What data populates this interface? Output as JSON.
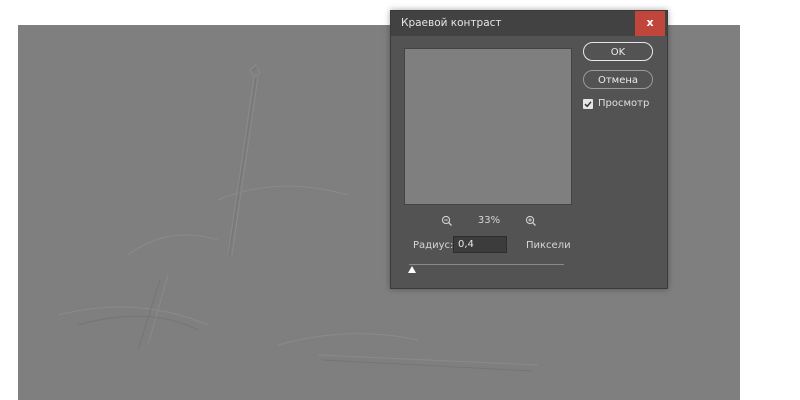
{
  "dialog": {
    "title": "Краевой контраст",
    "close_label": "x",
    "ok_label": "OK",
    "cancel_label": "Отмена",
    "preview_label": "Просмотр",
    "preview_checked": true,
    "zoom_level": "33%",
    "radius_label": "Радиус:",
    "radius_value": "0,4",
    "radius_units": "Пиксели",
    "slider_level": 0.02
  },
  "colors": {
    "dialog_bg": "#535353",
    "titlebar_bg": "#424242",
    "close_bg": "#c0453a",
    "canvas_gray": "#7f7f7f"
  },
  "icons": {
    "zoom_out": "zoom-out-icon",
    "zoom_in": "zoom-in-icon",
    "check": "checkmark-icon",
    "slider": "triangle-thumb-icon"
  }
}
